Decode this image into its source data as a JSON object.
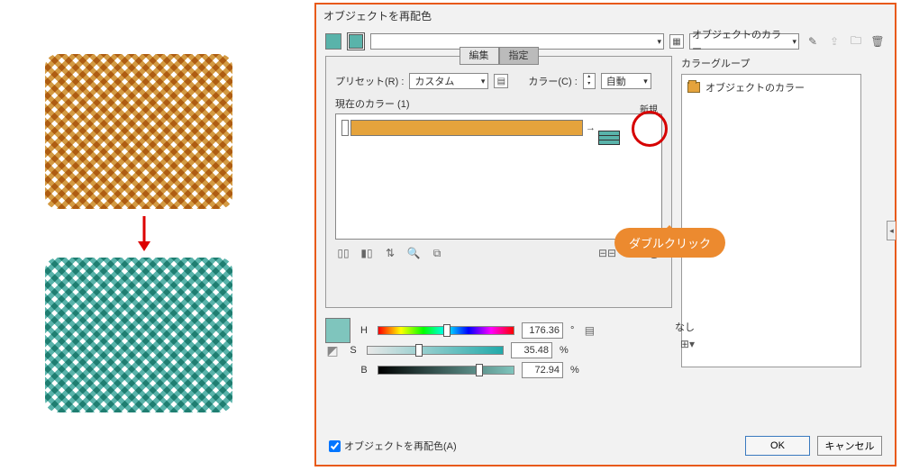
{
  "dialog_title": "オブジェクトを再配色",
  "topbar": {
    "group_label": "オブジェクトのカラー",
    "wand_icon": "wand-icon",
    "upload_icon": "upload-icon",
    "folder_icon": "folder-icon",
    "trash_icon": "trash-icon"
  },
  "tabs": {
    "edit": "編集",
    "assign": "指定"
  },
  "preset": {
    "label": "プリセット(R) :",
    "value": "カスタム"
  },
  "color_scheme": {
    "label": "カラー(C) :",
    "value": "自動"
  },
  "current_colors_label": "現在のカラー (1)",
  "new_label": "新規",
  "callout_text": "ダブルクリック",
  "none_text": "なし",
  "hsb": {
    "h": {
      "label": "H",
      "value": "176.36",
      "unit": "°"
    },
    "s": {
      "label": "S",
      "value": "35.48",
      "unit": "%"
    },
    "b": {
      "label": "B",
      "value": "72.94",
      "unit": "%"
    }
  },
  "group_panel": {
    "heading": "カラーグループ",
    "item": "オブジェクトのカラー"
  },
  "recolor_checkbox": "オブジェクトを再配色(A)",
  "buttons": {
    "ok": "OK",
    "cancel": "キャンセル"
  },
  "colors": {
    "tan": "#d39a43",
    "teal": "#59b3aa",
    "callout": "#ec8a2f"
  }
}
